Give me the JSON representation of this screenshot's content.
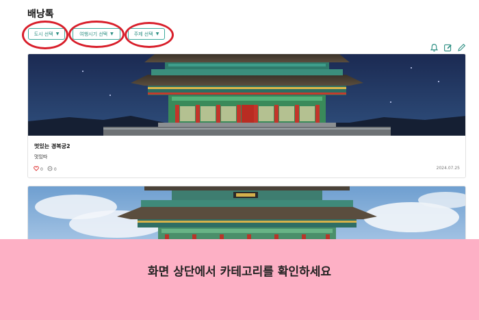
{
  "header": {
    "title": "배낭톡"
  },
  "filters": [
    {
      "label": "도시 선택"
    },
    {
      "label": "여행시기 선택"
    },
    {
      "label": "주제 선택"
    }
  ],
  "toolbar_icons": [
    "bell-icon",
    "edit-square-icon",
    "pencil-icon"
  ],
  "posts": [
    {
      "title": "멋있는 경복궁2",
      "body": "멋있따",
      "likes": "0",
      "comments": "0",
      "date": "2024.07.25"
    },
    {
      "title": "",
      "body": "",
      "likes": "",
      "comments": "",
      "date": ""
    }
  ],
  "overlay": {
    "instruction": "화면 상단에서 카테고리를 확인하세요",
    "color": "#fdb0c5"
  },
  "colors": {
    "accent": "#3aa99c",
    "highlight_ring": "#d81e2a"
  }
}
